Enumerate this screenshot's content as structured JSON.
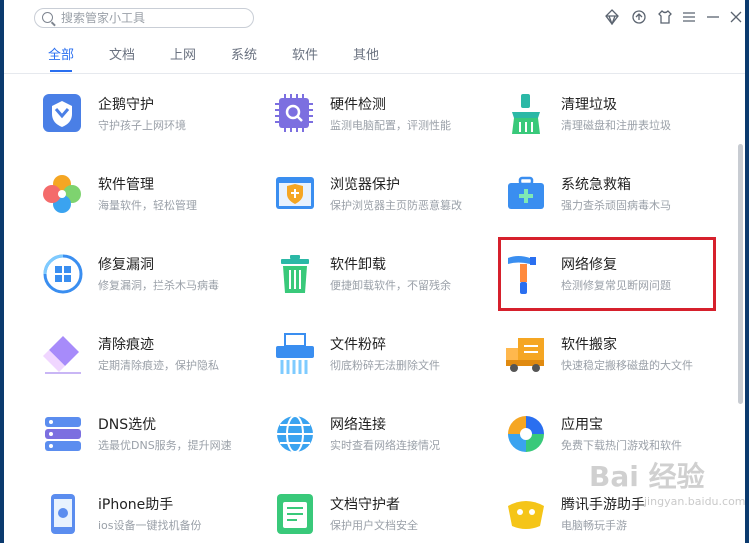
{
  "search": {
    "placeholder": "搜索管家小工具"
  },
  "window_controls": [
    "diamond-icon",
    "recycle-icon",
    "shirt-icon",
    "menu-icon",
    "minimize-icon",
    "close-icon"
  ],
  "tabs": [
    {
      "label": "全部",
      "active": true
    },
    {
      "label": "文档"
    },
    {
      "label": "上网"
    },
    {
      "label": "系统"
    },
    {
      "label": "软件"
    },
    {
      "label": "其他"
    }
  ],
  "tools": [
    {
      "name": "企鹅守护",
      "desc": "守护孩子上网环境",
      "icon": "shield-icon"
    },
    {
      "name": "硬件检测",
      "desc": "监测电脑配置，评测性能",
      "icon": "chip-icon"
    },
    {
      "name": "清理垃圾",
      "desc": "清理磁盘和注册表垃圾",
      "icon": "broom-icon"
    },
    {
      "name": "软件管理",
      "desc": "海量软件，轻松管理",
      "icon": "flower-icon"
    },
    {
      "name": "浏览器保护",
      "desc": "保护浏览器主页防恶意篡改",
      "icon": "browser-shield-icon"
    },
    {
      "name": "系统急救箱",
      "desc": "强力查杀顽固病毒木马",
      "icon": "first-aid-icon"
    },
    {
      "name": "修复漏洞",
      "desc": "修复漏洞，拦杀木马病毒",
      "icon": "windows-repair-icon"
    },
    {
      "name": "软件卸载",
      "desc": "便捷卸载软件，不留残余",
      "icon": "trash-icon"
    },
    {
      "name": "网络修复",
      "desc": "检测修复常见断网问题",
      "icon": "hammer-icon"
    },
    {
      "name": "清除痕迹",
      "desc": "定期清除痕迹，保护隐私",
      "icon": "eraser-icon"
    },
    {
      "name": "文件粉碎",
      "desc": "彻底粉碎无法删除文件",
      "icon": "shredder-icon"
    },
    {
      "name": "软件搬家",
      "desc": "快速稳定搬移磁盘的大文件",
      "icon": "truck-icon"
    },
    {
      "name": "DNS选优",
      "desc": "选最优DNS服务，提升网速",
      "icon": "server-icon"
    },
    {
      "name": "网络连接",
      "desc": "实时查看网络连接情况",
      "icon": "globe-icon"
    },
    {
      "name": "应用宝",
      "desc": "免费下载热门游戏和软件",
      "icon": "app-store-icon"
    },
    {
      "name": "iPhone助手",
      "desc": "ios设备一键找机备份",
      "icon": "phone-icon"
    },
    {
      "name": "文档守护者",
      "desc": "保护用户文档安全",
      "icon": "document-icon"
    },
    {
      "name": "腾讯手游助手",
      "desc": "电脑畅玩手游",
      "icon": "game-icon"
    }
  ],
  "watermark": {
    "text": "Bai 经验",
    "sub": "jingyan.baidu.com"
  },
  "colors": {
    "accent": "#2a6ff0",
    "highlight": "#d6202c"
  }
}
